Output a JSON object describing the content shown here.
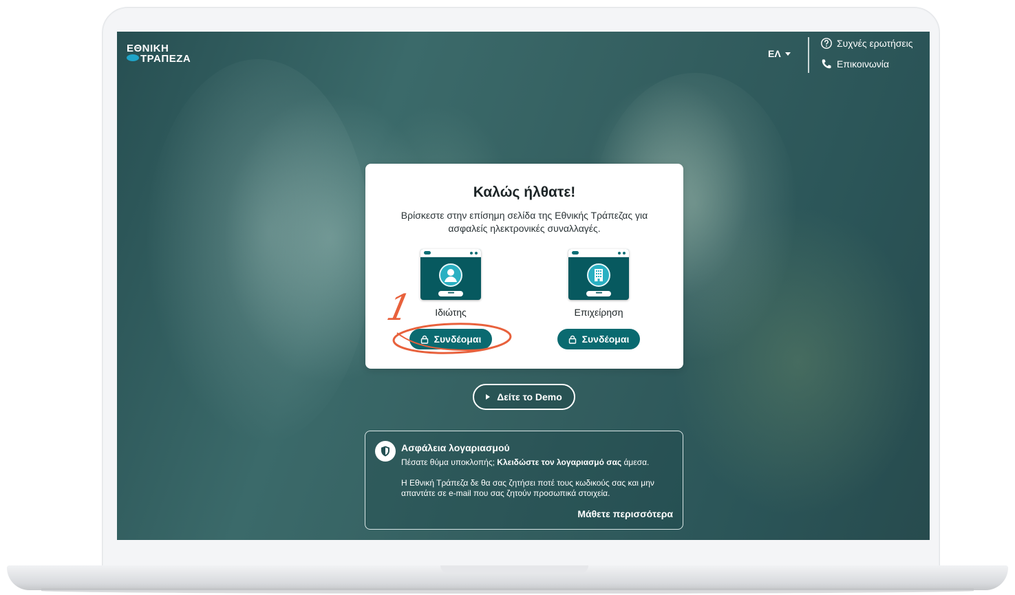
{
  "header": {
    "logo_line1": "ΕΘΝΙΚΗ",
    "logo_line2": "ΤΡΑΠΕΖΑ",
    "language": "ΕΛ",
    "faq_link": "Συχνές ερωτήσεις",
    "contact_link": "Επικοινωνία"
  },
  "welcome": {
    "title": "Καλώς ήλθατε!",
    "subtitle": "Βρίσκεστε στην επίσημη σελίδα της Εθνικής Τράπεζας για ασφαλείς ηλεκτρονικές συναλλαγές.",
    "options": [
      {
        "label": "Ιδιώτης",
        "button": "Συνδέομαι",
        "password_mask": "••••••"
      },
      {
        "label": "Επιχείρηση",
        "button": "Συνδέομαι",
        "password_mask": "••••••"
      }
    ]
  },
  "annotation": {
    "number": "1",
    "color": "#e8613c"
  },
  "demo": {
    "label": "Δείτε το Demo"
  },
  "security": {
    "title": "Ασφάλεια λογαριασμού",
    "line1_prefix": "Πέσατε θύμα υποκλοπής;",
    "line1_bold": "Κλειδώστε τον λογαριασμό σας",
    "line1_suffix": "άμεσα.",
    "body": "Η Εθνική Τράπεζα δε θα σας ζητήσει ποτέ τους κωδικούς σας και μην απαντάτε σε e-mail που σας ζητούν προσωπικά στοιχεία.",
    "learn_more": "Μάθετε περισσότερα"
  },
  "colors": {
    "brand_teal": "#0a6a70",
    "accent_blue": "#1fa4c8",
    "annotation_red": "#e8613c"
  }
}
